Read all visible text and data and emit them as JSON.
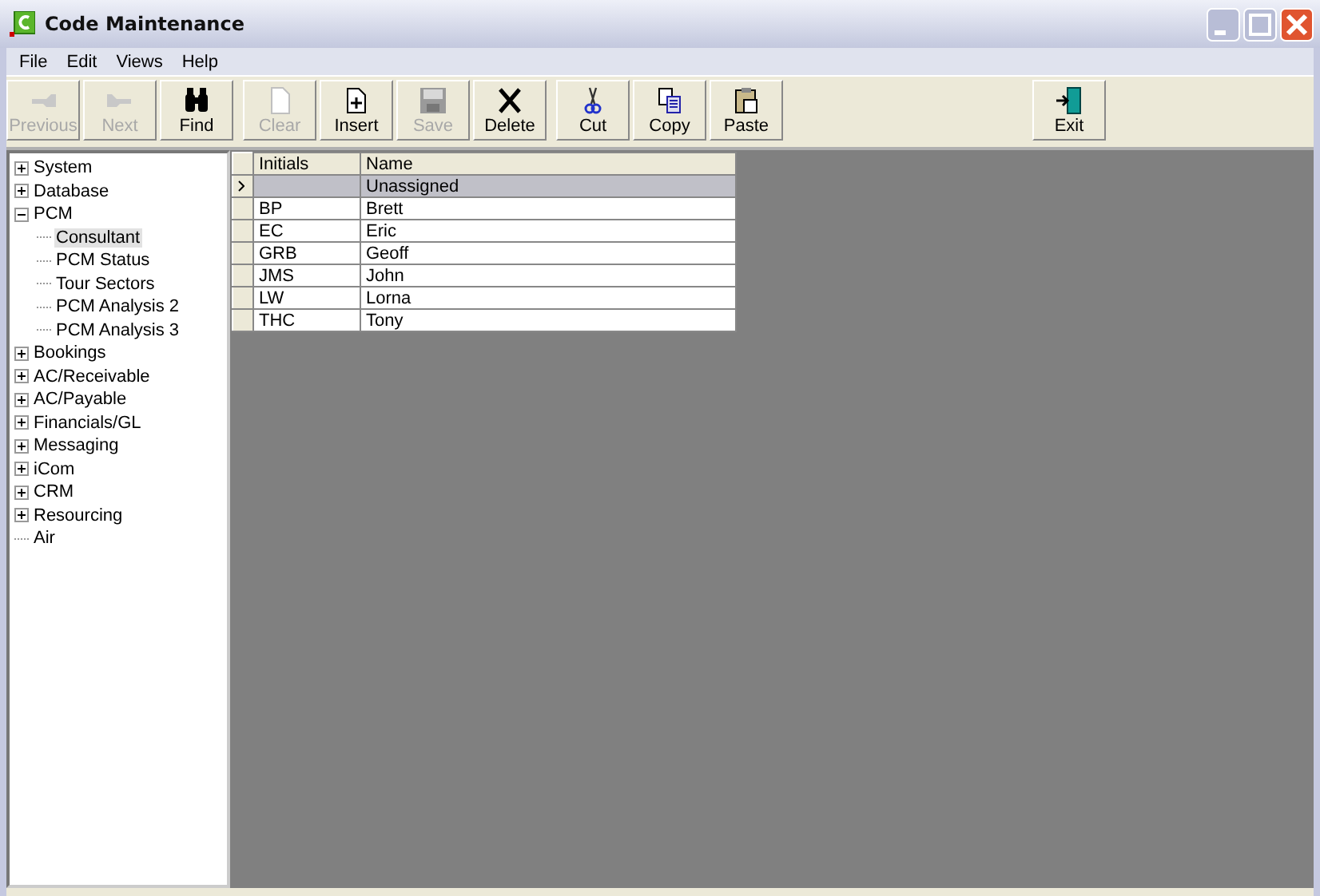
{
  "window": {
    "title": "Code Maintenance"
  },
  "menu": [
    "File",
    "Edit",
    "Views",
    "Help"
  ],
  "toolbar": [
    {
      "label": "Previous",
      "disabled": true
    },
    {
      "label": "Next",
      "disabled": true
    },
    {
      "label": "Find",
      "disabled": false
    },
    {
      "label": "Clear",
      "disabled": true
    },
    {
      "label": "Insert",
      "disabled": false
    },
    {
      "label": "Save",
      "disabled": true
    },
    {
      "label": "Delete",
      "disabled": false
    },
    {
      "label": "Cut",
      "disabled": false
    },
    {
      "label": "Copy",
      "disabled": false
    },
    {
      "label": "Paste",
      "disabled": false
    },
    {
      "label": "Exit",
      "disabled": false
    }
  ],
  "tree": [
    {
      "label": "System",
      "expanded": false,
      "selected": false
    },
    {
      "label": "Database",
      "expanded": false,
      "selected": false
    },
    {
      "label": "PCM",
      "expanded": true,
      "selected": false,
      "children": [
        {
          "label": "Consultant",
          "selected": true
        },
        {
          "label": "PCM Status",
          "selected": false
        },
        {
          "label": "Tour Sectors",
          "selected": false
        },
        {
          "label": "PCM Analysis 2",
          "selected": false
        },
        {
          "label": "PCM Analysis 3",
          "selected": false
        }
      ]
    },
    {
      "label": "Bookings",
      "expanded": false,
      "selected": false
    },
    {
      "label": "AC/Receivable",
      "expanded": false,
      "selected": false
    },
    {
      "label": "AC/Payable",
      "expanded": false,
      "selected": false
    },
    {
      "label": "Financials/GL",
      "expanded": false,
      "selected": false
    },
    {
      "label": "Messaging",
      "expanded": false,
      "selected": false
    },
    {
      "label": "iCom",
      "expanded": false,
      "selected": false
    },
    {
      "label": "CRM",
      "expanded": false,
      "selected": false
    },
    {
      "label": "Resourcing",
      "expanded": false,
      "selected": false
    },
    {
      "label": "Air",
      "selected": false
    }
  ],
  "grid": {
    "columns": [
      "Initials",
      "Name"
    ],
    "rows": [
      {
        "cells": [
          "",
          "Unassigned"
        ],
        "selected": true
      },
      {
        "cells": [
          "BP",
          "Brett"
        ],
        "selected": false
      },
      {
        "cells": [
          "EC",
          "Eric"
        ],
        "selected": false
      },
      {
        "cells": [
          "GRB",
          "Geoff"
        ],
        "selected": false
      },
      {
        "cells": [
          "JMS",
          "John"
        ],
        "selected": false
      },
      {
        "cells": [
          "LW",
          "Lorna"
        ],
        "selected": false
      },
      {
        "cells": [
          "THC",
          "Tony"
        ],
        "selected": false
      }
    ]
  }
}
